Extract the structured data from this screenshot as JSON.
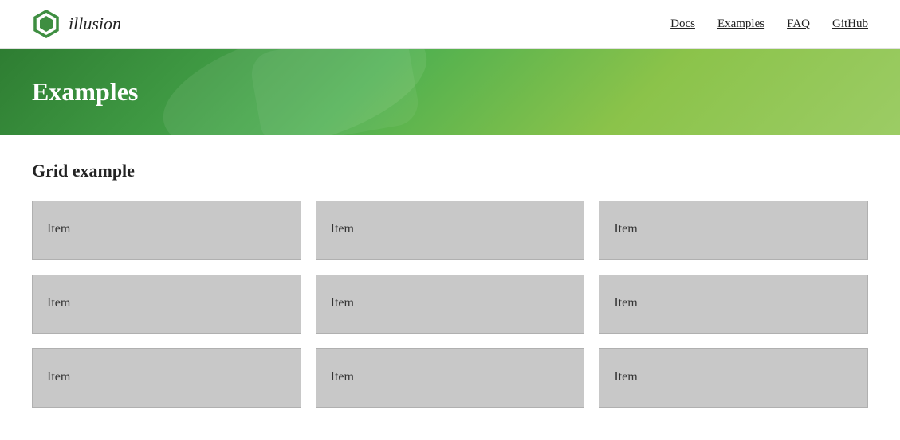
{
  "brand": {
    "name": "illusion",
    "logo_color_outer": "#3e8e41",
    "logo_color_inner": "#1a5c1e"
  },
  "navbar": {
    "links": [
      {
        "label": "Docs",
        "href": "#"
      },
      {
        "label": "Examples",
        "href": "#"
      },
      {
        "label": "FAQ",
        "href": "#"
      },
      {
        "label": "GitHub",
        "href": "#"
      }
    ]
  },
  "hero": {
    "title": "Examples"
  },
  "section": {
    "title": "Grid example"
  },
  "grid": {
    "items": [
      {
        "label": "Item"
      },
      {
        "label": "Item"
      },
      {
        "label": "Item"
      },
      {
        "label": "Item"
      },
      {
        "label": "Item"
      },
      {
        "label": "Item"
      },
      {
        "label": "Item"
      },
      {
        "label": "Item"
      },
      {
        "label": "Item"
      }
    ]
  }
}
